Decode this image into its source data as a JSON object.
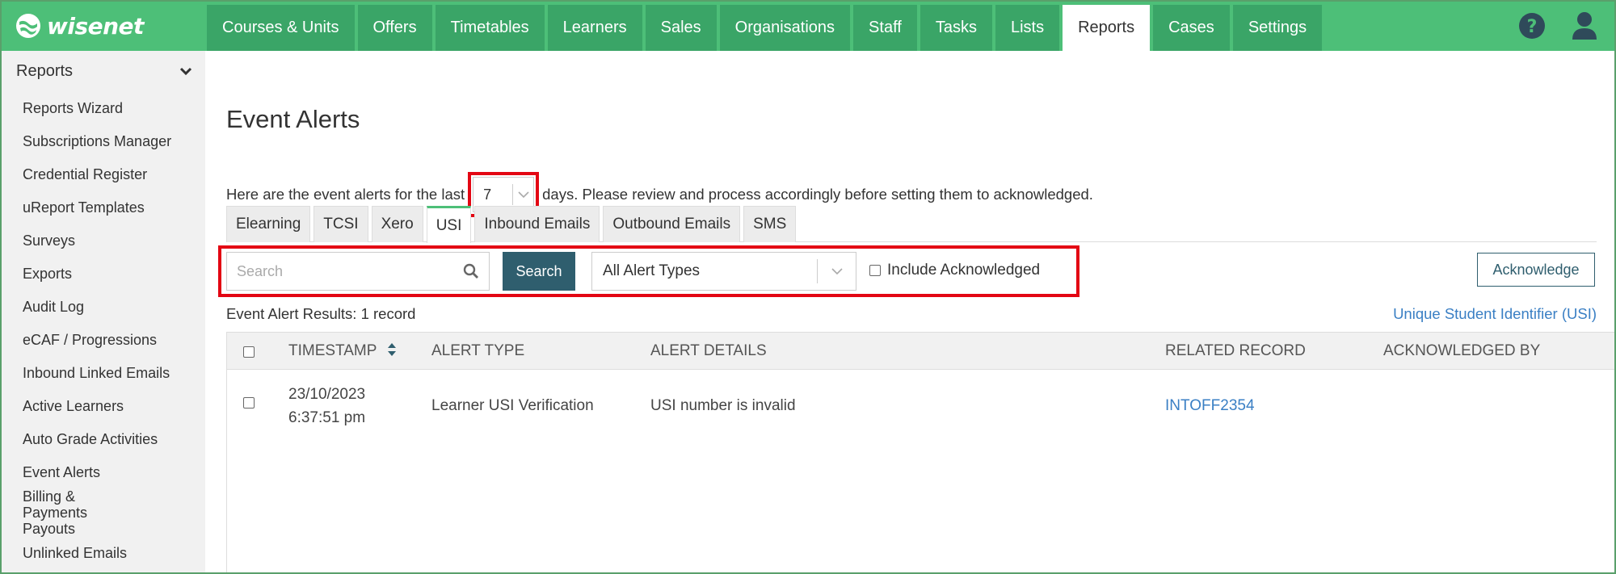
{
  "app": {
    "logo_text": "wisenet"
  },
  "nav": {
    "tabs": [
      {
        "label": "Courses & Units"
      },
      {
        "label": "Offers"
      },
      {
        "label": "Timetables"
      },
      {
        "label": "Learners"
      },
      {
        "label": "Sales"
      },
      {
        "label": "Organisations"
      },
      {
        "label": "Staff"
      },
      {
        "label": "Tasks"
      },
      {
        "label": "Lists"
      },
      {
        "label": "Reports"
      },
      {
        "label": "Cases"
      },
      {
        "label": "Settings"
      }
    ],
    "active_tab": "Reports",
    "icons": [
      "help-icon",
      "user-icon"
    ]
  },
  "sidebar": {
    "title": "Reports",
    "items": [
      {
        "label": "Reports Wizard"
      },
      {
        "label": "Subscriptions Manager"
      },
      {
        "label": "Credential Register"
      },
      {
        "label": "uReport Templates"
      },
      {
        "label": "Surveys"
      },
      {
        "label": "Exports"
      },
      {
        "label": "Audit Log"
      },
      {
        "label": "eCAF / Progressions"
      },
      {
        "label": "Inbound Linked Emails"
      },
      {
        "label": "Active Learners"
      },
      {
        "label": "Auto Grade Activities"
      },
      {
        "label": "Event Alerts"
      },
      {
        "label": "Billing & Payments Payouts"
      },
      {
        "label": "Unlinked Emails"
      }
    ]
  },
  "main": {
    "title": "Event Alerts",
    "intro_before": "Here are the event alerts for the last",
    "days_value": "7",
    "intro_after": "days. Please review and process accordingly before setting them to acknowledged.",
    "subtabs": [
      {
        "label": "Elearning"
      },
      {
        "label": "TCSI"
      },
      {
        "label": "Xero"
      },
      {
        "label": "USI"
      },
      {
        "label": "Inbound Emails"
      },
      {
        "label": "Outbound Emails"
      },
      {
        "label": "SMS"
      }
    ],
    "active_subtab": "USI",
    "search_placeholder": "Search",
    "search_button": "Search",
    "alert_type_value": "All Alert Types",
    "include_ack_label": "Include Acknowledged",
    "ack_button": "Acknowledge",
    "results_text": "Event Alert Results: 1 record",
    "usi_link": "Unique Student Identifier (USI)",
    "table": {
      "headers": {
        "timestamp": "TIMESTAMP",
        "alert_type": "ALERT TYPE",
        "alert_details": "ALERT DETAILS",
        "related_record": "RELATED RECORD",
        "acknowledged_by": "ACKNOWLEDGED BY"
      },
      "rows": [
        {
          "date": "23/10/2023",
          "time": "6:37:51 pm",
          "alert_type": "Learner USI Verification",
          "alert_details": "USI number is invalid",
          "related_record": "INTOFF2354",
          "acknowledged_by": ""
        }
      ]
    }
  },
  "colors": {
    "brand_green": "#4dbf78",
    "tab_green": "#3aa567",
    "accent_dark": "#2f5e6e",
    "highlight_red": "#e30613",
    "link_blue": "#3a7fc4"
  }
}
